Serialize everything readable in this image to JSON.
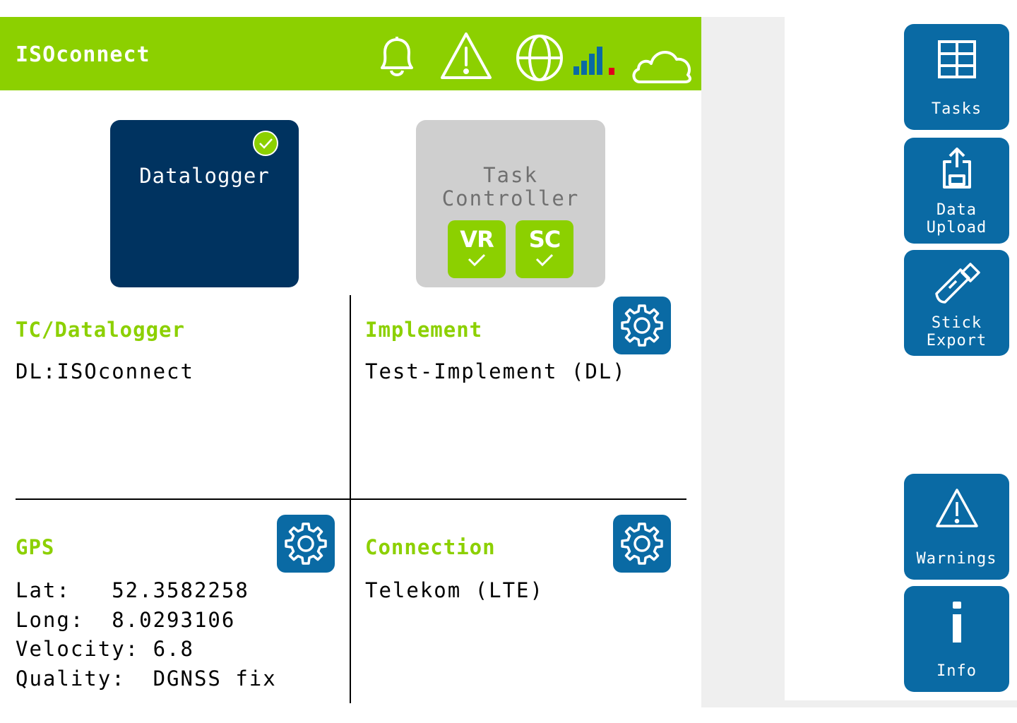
{
  "header": {
    "title": "ISOconnect",
    "icons": [
      "bell-icon",
      "warning-icon",
      "globe-icon",
      "signal-icon",
      "cloud-icon"
    ]
  },
  "apps": {
    "datalogger": {
      "label": "Datalogger",
      "status": "active-check"
    },
    "task_controller": {
      "label": "Task\nController",
      "badges": [
        "VR",
        "SC"
      ]
    }
  },
  "sections": {
    "tc_datalogger": {
      "title": "TC/Datalogger",
      "value": "DL:ISOconnect"
    },
    "implement": {
      "title": "Implement",
      "value": "Test-Implement (DL)"
    },
    "gps": {
      "title": "GPS",
      "lines": [
        "Lat:   52.3582258",
        "Long:  8.0293106",
        "Velocity: 6.8",
        "Quality:  DGNSS fix"
      ]
    },
    "connection": {
      "title": "Connection",
      "value": "Telekom (LTE)"
    }
  },
  "sidebar": {
    "tasks": "Tasks",
    "data_upload": "Data\nUpload",
    "stick_export": "Stick\nExport",
    "warnings": "Warnings",
    "info": "Info"
  },
  "colors": {
    "accent_green": "#8cd000",
    "button_blue": "#0a6aa4",
    "tile_navy": "#003360",
    "tile_grey": "#cfcfcf"
  }
}
